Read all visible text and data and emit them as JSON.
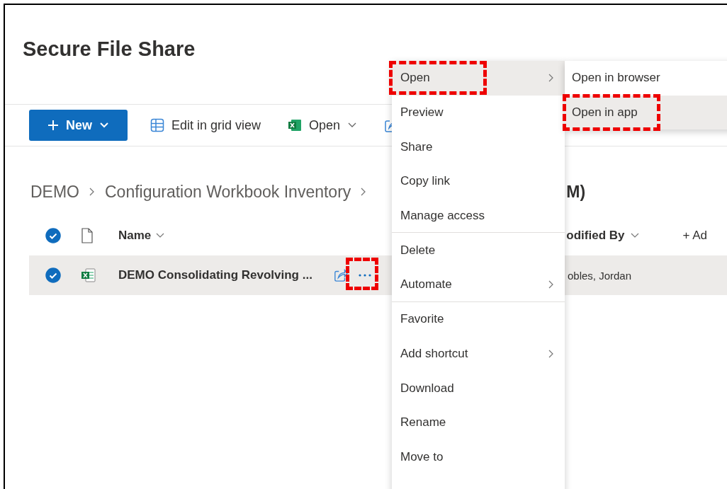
{
  "page": {
    "title": "Secure File Share"
  },
  "toolbar": {
    "new_button": "New",
    "items": [
      {
        "kind": "grid",
        "label": "Edit in grid view",
        "dropdown": false
      },
      {
        "kind": "excel",
        "label": "Open",
        "dropdown": true
      }
    ]
  },
  "breadcrumb": [
    "DEMO",
    "Configuration Workbook Inventory"
  ],
  "breadcrumb_tail": "M)",
  "table": {
    "all_selected": true,
    "columns": [
      {
        "label": "Name"
      },
      {
        "label": "odified By"
      }
    ],
    "add_column": "+ Ad",
    "rows": [
      {
        "selected": true,
        "name": "DEMO Consolidating Revolving ...",
        "modified_by": "obles, Jordan",
        "more_annotated": true
      }
    ]
  },
  "context_menu": {
    "items": [
      {
        "label": "Open",
        "submenu": true,
        "hovered": true,
        "annotated": true,
        "divider_after": false
      },
      {
        "label": "Preview",
        "submenu": false,
        "hovered": false,
        "annotated": false,
        "divider_after": false
      },
      {
        "label": "Share",
        "submenu": false,
        "hovered": false,
        "annotated": false,
        "divider_after": false
      },
      {
        "label": "Copy link",
        "submenu": false,
        "hovered": false,
        "annotated": false,
        "divider_after": false
      },
      {
        "label": "Manage access",
        "submenu": false,
        "hovered": false,
        "annotated": false,
        "divider_after": true
      },
      {
        "label": "Delete",
        "submenu": false,
        "hovered": false,
        "annotated": false,
        "divider_after": false
      },
      {
        "label": "Automate",
        "submenu": true,
        "hovered": false,
        "annotated": false,
        "divider_after": true
      },
      {
        "label": "Favorite",
        "submenu": false,
        "hovered": false,
        "annotated": false,
        "divider_after": false
      },
      {
        "label": "Add shortcut",
        "submenu": true,
        "hovered": false,
        "annotated": false,
        "divider_after": false
      },
      {
        "label": "Download",
        "submenu": false,
        "hovered": false,
        "annotated": false,
        "divider_after": false
      },
      {
        "label": "Rename",
        "submenu": false,
        "hovered": false,
        "annotated": false,
        "divider_after": false
      },
      {
        "label": "Move to",
        "submenu": false,
        "hovered": false,
        "annotated": false,
        "divider_after": false
      }
    ]
  },
  "submenu": {
    "items": [
      {
        "label": "Open in browser",
        "hovered": false,
        "annotated": false
      },
      {
        "label": "Open in app",
        "hovered": true,
        "annotated": true
      }
    ]
  }
}
